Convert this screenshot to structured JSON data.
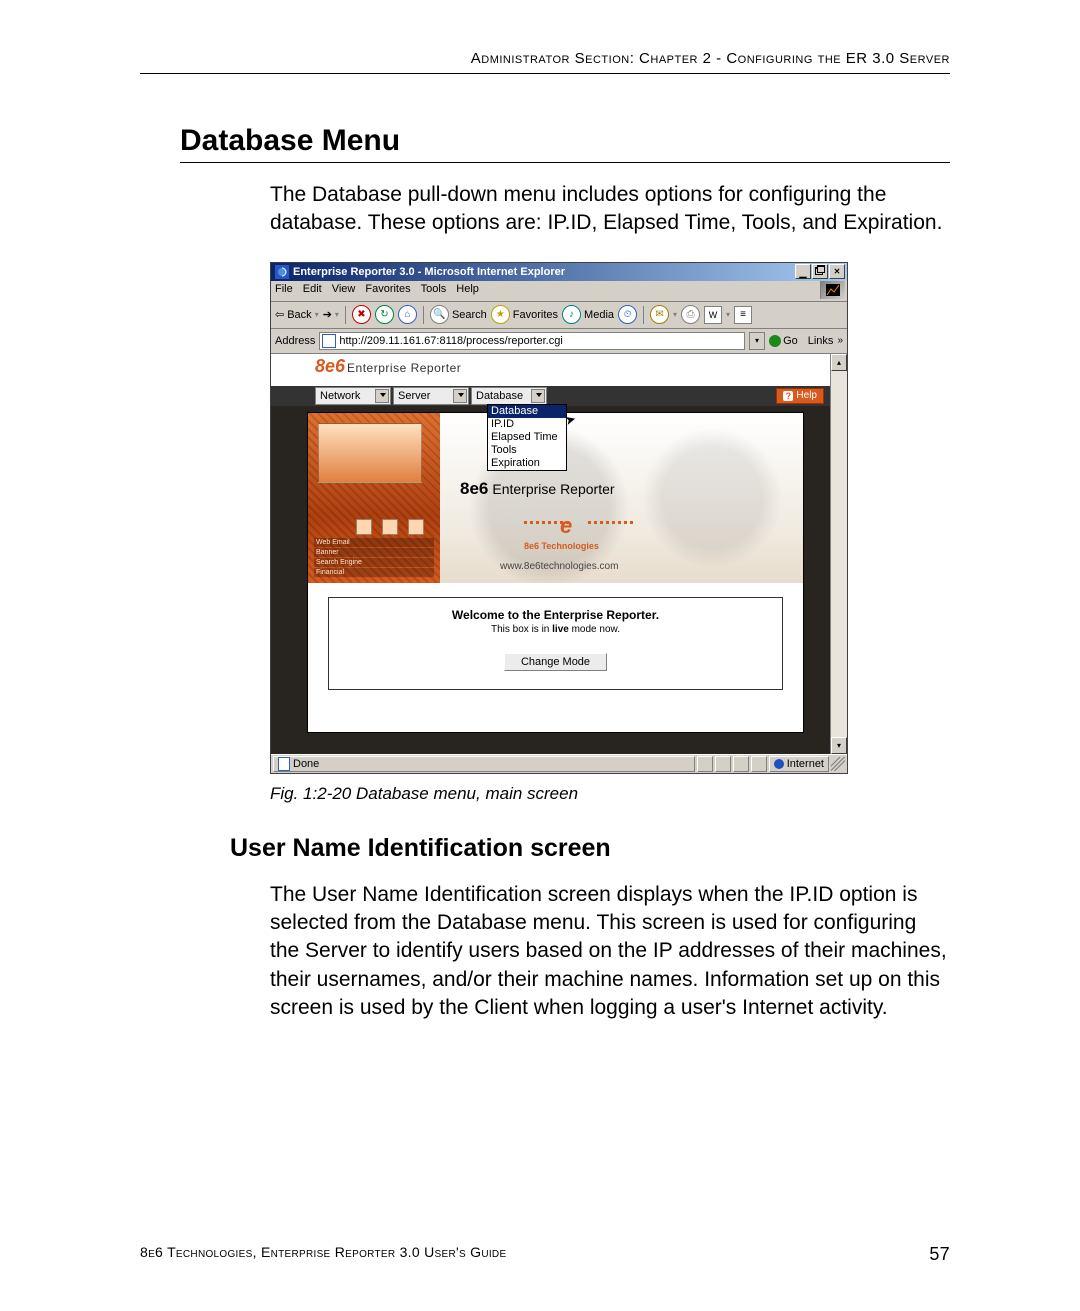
{
  "header": {
    "running_head": "Administrator Section: Chapter 2 - Configuring the ER 3.0 Server"
  },
  "footer": {
    "running_foot": "8e6 Technologies, Enterprise Reporter 3.0 User's Guide",
    "page_number": "57"
  },
  "section": {
    "title": "Database Menu",
    "intro": "The Database pull-down menu includes options for configuring the database. These options are: IP.ID, Elapsed Time, Tools, and Expiration."
  },
  "figure": {
    "caption": "Fig. 1:2-20  Database menu, main screen"
  },
  "subsection": {
    "title": "User Name Identification screen",
    "body": "The User Name Identification screen displays when the IP.ID option is selected from the Database menu. This screen is used for configuring the Server to identify users based on the IP addresses of their machines, their usernames, and/or their machine names. Information set up on this screen is used by the Client when logging a user's Internet activity."
  },
  "ie": {
    "title": "Enterprise Reporter 3.0 - Microsoft Internet Explorer",
    "menus": [
      "File",
      "Edit",
      "View",
      "Favorites",
      "Tools",
      "Help"
    ],
    "toolbar": {
      "back": "Back",
      "search": "Search",
      "favorites": "Favorites",
      "media": "Media"
    },
    "address_label": "Address",
    "url": "http://209.11.161.67:8118/process/reporter.cgi",
    "go": "Go",
    "links": "Links",
    "status_done": "Done",
    "status_zone": "Internet"
  },
  "app": {
    "logo_main": "8e6",
    "logo_sub": "Enterprise Reporter",
    "menus": {
      "network": "Network",
      "server": "Server",
      "database": "Database"
    },
    "help": "Help",
    "dropdown": {
      "items": [
        "Database",
        "IP.ID",
        "Elapsed Time",
        "Tools",
        "Expiration"
      ],
      "selected_index": 0
    },
    "hero": {
      "brand_bold": "8e6",
      "brand_rest": "Enterprise Reporter",
      "tech_label": "8e6 Technologies",
      "url": "www.8e6technologies.com",
      "left_labels": [
        "Web Email",
        "Banner",
        "Search Engine",
        "Financial"
      ]
    },
    "welcome": {
      "title": "Welcome to the Enterprise Reporter.",
      "subtitle_prefix": "This box is in ",
      "subtitle_bold": "live",
      "subtitle_suffix": " mode now.",
      "button": "Change Mode"
    }
  }
}
